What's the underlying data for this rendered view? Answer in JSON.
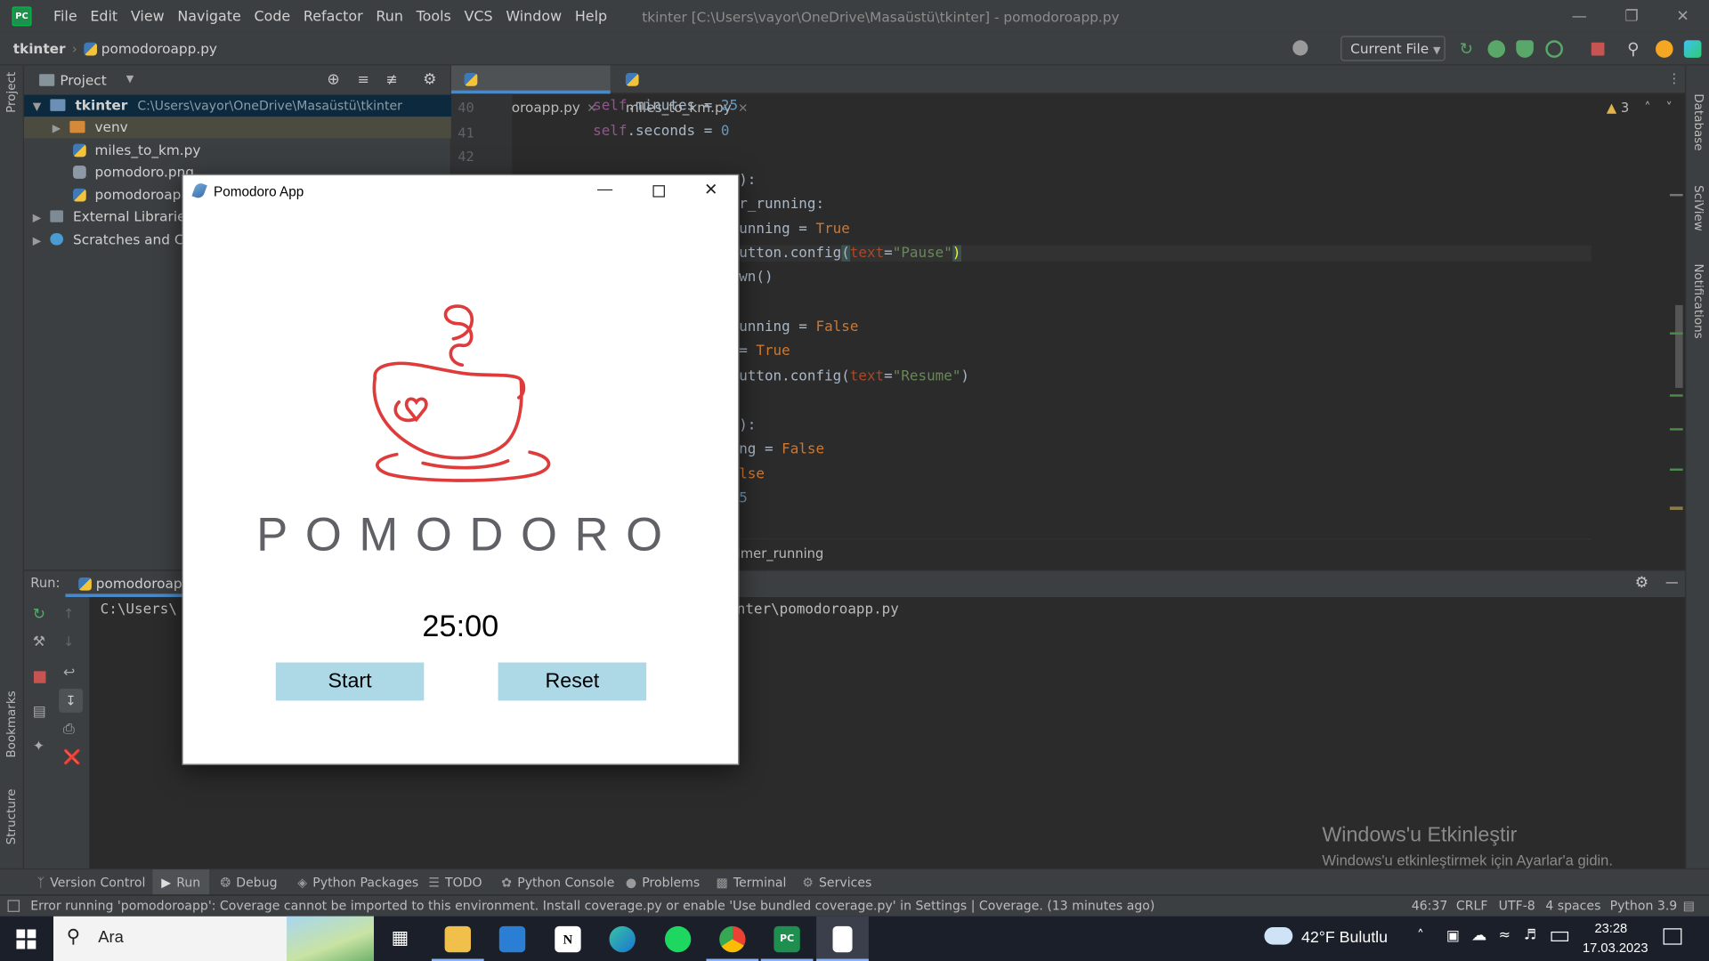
{
  "titlebar": {
    "menu": [
      "File",
      "Edit",
      "View",
      "Navigate",
      "Code",
      "Refactor",
      "Run",
      "Tools",
      "VCS",
      "Window",
      "Help"
    ],
    "title": "tkinter [C:\\Users\\vayor\\OneDrive\\Masaüstü\\tkinter] - pomodoroapp.py"
  },
  "navbar": {
    "project": "tkinter",
    "file": "pomodoroapp.py",
    "run_config": "Current File"
  },
  "project_panel": {
    "title": "Project",
    "root_name": "tkinter",
    "root_path": "C:\\Users\\vayor\\OneDrive\\Masaüstü\\tkinter",
    "items": [
      "venv",
      "miles_to_km.py",
      "pomodoro.png",
      "pomodoroapp.",
      "External Libraries",
      "Scratches and Cons"
    ]
  },
  "editor": {
    "tabs": [
      "pomodoroapp.py",
      "miles_to_km.py"
    ],
    "line_numbers": [
      "40",
      "41",
      "42"
    ],
    "inspections": "3",
    "breadcrumb": "imer_running"
  },
  "side_labels": {
    "left_top": "Project",
    "left_bookmarks": "Bookmarks",
    "left_structure": "Structure",
    "right": [
      "Database",
      "SciView",
      "Notifications"
    ]
  },
  "run_panel": {
    "label": "Run:",
    "tab": "pomodoroapp",
    "console_path_start": "C:\\Users\\",
    "console_path_end": "nter\\pomodoroapp.py"
  },
  "bottom_tabs": [
    "Version Control",
    "Run",
    "Debug",
    "Python Packages",
    "TODO",
    "Python Console",
    "Problems",
    "Terminal",
    "Services"
  ],
  "status": {
    "message": "Error running 'pomodoroapp': Coverage cannot be imported to this environment. Install coverage.py or enable 'Use bundled coverage.py' in Settings | Coverage. (13 minutes ago)",
    "position": "46:37",
    "line_sep": "CRLF",
    "encoding": "UTF-8",
    "indent": "4 spaces",
    "interpreter": "Python 3.9"
  },
  "watermark": {
    "title": "Windows'u Etkinleştir",
    "subtitle": "Windows'u etkinleştirmek için Ayarlar'a gidin."
  },
  "taskbar": {
    "search": "Ara",
    "weather": "42°F Bulutlu",
    "time": "23:28",
    "date": "17.03.2023"
  },
  "pomodoro_app": {
    "title": "Pomodoro App",
    "logo_text": "POMODORO",
    "timer": "25:00",
    "start_label": "Start",
    "reset_label": "Reset"
  },
  "colors": {
    "ide_bg": "#2b2b2b",
    "ide_panel": "#3c3f41",
    "button_bg": "#add8e6",
    "logo_red": "#e03b3b",
    "logo_gray": "#5f6166"
  }
}
